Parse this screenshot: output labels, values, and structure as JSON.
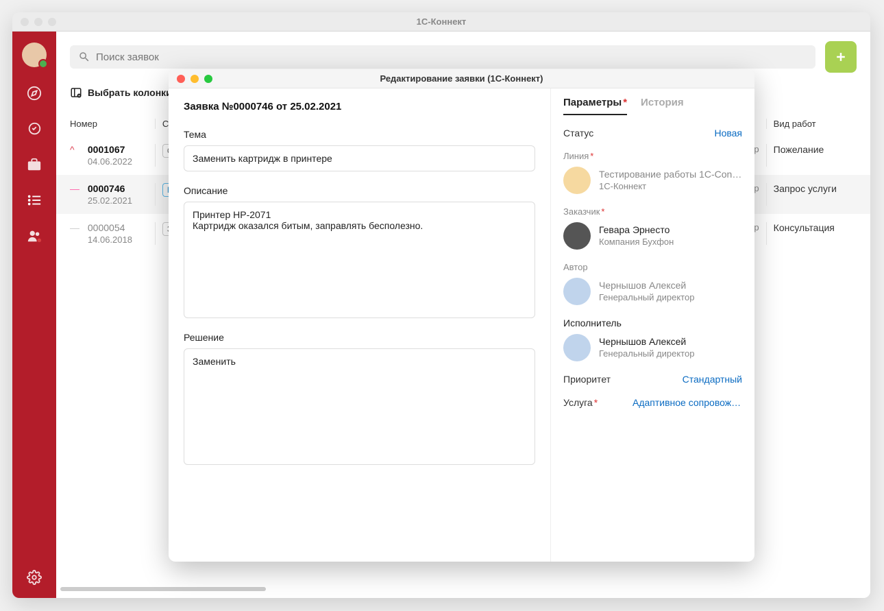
{
  "window": {
    "title": "1C-Коннект"
  },
  "search": {
    "placeholder": "Поиск заявок"
  },
  "columns_button": "Выбрать колонки",
  "table": {
    "headers": {
      "number": "Номер",
      "status": "С",
      "worktype": "Вид работ"
    },
    "rows": [
      {
        "number": "0001067",
        "date": "04.06.2022",
        "status": "О",
        "suffix": "эр",
        "worktype": "Пожелание"
      },
      {
        "number": "0000746",
        "date": "25.02.2021",
        "status": "Н",
        "suffix": "эр",
        "worktype": "Запрос услуги"
      },
      {
        "number": "0000054",
        "date": "14.06.2018",
        "status": "За",
        "suffix": "эр",
        "worktype": "Консультация"
      }
    ]
  },
  "modal": {
    "title": "Редактирование заявки (1С-Коннект)",
    "header": "Заявка №0000746 от 25.02.2021",
    "labels": {
      "subject": "Тема",
      "description": "Описание",
      "solution": "Решение"
    },
    "subject": "Заменить картридж в принтере",
    "description": "Принтер HP-2071\nКартридж оказался битым, заправлять бесполезно.",
    "solution": "Заменить",
    "tabs": {
      "params": "Параметры",
      "history": "История"
    },
    "params": {
      "status_label": "Статус",
      "status_value": "Новая",
      "line_label": "Линия",
      "line_name": "Тестирование работы 1С-Con…",
      "line_sub": "1С-Коннект",
      "customer_label": "Заказчик",
      "customer_name": "Гевара Эрнесто",
      "customer_sub": "Компания Бухфон",
      "author_label": "Автор",
      "author_name": "Чернышов Алексей",
      "author_sub": "Генеральный директор",
      "assignee_label": "Исполнитель",
      "assignee_name": "Чернышов Алексей",
      "assignee_sub": "Генеральный директор",
      "priority_label": "Приоритет",
      "priority_value": "Стандартный",
      "service_label": "Услуга",
      "service_value": "Адаптивное сопровождение п…"
    }
  }
}
